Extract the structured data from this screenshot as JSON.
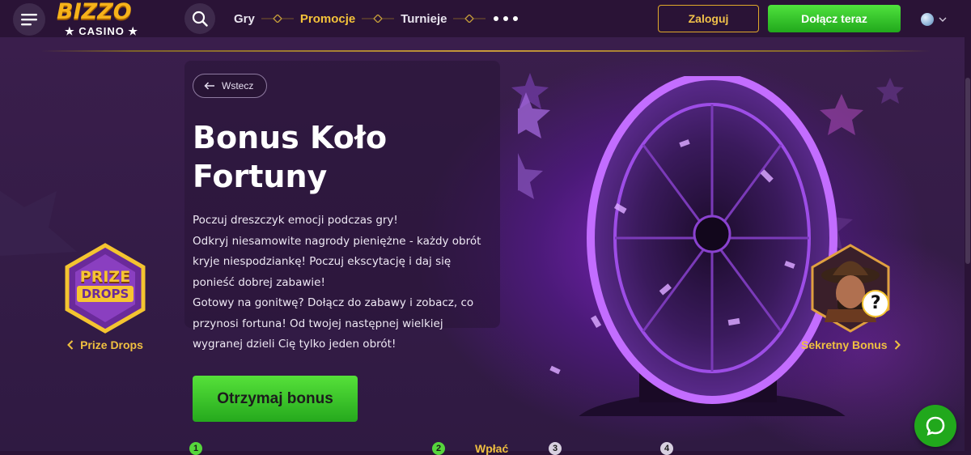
{
  "header": {
    "logo_text": "BIZZO",
    "logo_subtext": "★ CASINO ★",
    "nav": [
      {
        "label": "Gry",
        "active": false
      },
      {
        "label": "Promocje",
        "active": true
      },
      {
        "label": "Turnieje",
        "active": false
      }
    ],
    "login_label": "Zaloguj",
    "join_label": "Dołącz teraz"
  },
  "hero": {
    "back_label": "Wstecz",
    "title": "Bonus Koło Fortuny",
    "description": [
      "Poczuj dreszczyk emocji podczas gry!",
      "Odkryj niesamowite nagrody pieniężne - każdy obrót kryje niespodziankę! Poczuj ekscytację i daj się ponieść dobrej zabawie!",
      "Gotowy na gonitwę? Dołącz do zabawy i zobacz, co przynosi fortuna! Od twojej następnej wielkiej wygranej dzieli Cię tylko jeden obrót!"
    ],
    "cta_label": "Otrzymaj bonus",
    "prev_promo": {
      "label": "Prize Drops",
      "badge_line1": "PRIZE",
      "badge_line2": "DROPS"
    },
    "next_promo": {
      "label": "Sekretny Bonus"
    }
  },
  "steps": [
    {
      "number": "1",
      "text": ""
    },
    {
      "number": "2",
      "text": "Wpłać"
    },
    {
      "number": "3",
      "text": ""
    },
    {
      "number": "4",
      "text": ""
    }
  ],
  "colors": {
    "accent_gold": "#f0c040",
    "cta_green": "#3fc92d",
    "background": "#2a1336",
    "wheel_purple": "#a24ee8"
  },
  "icons": {
    "menu": "hamburger-icon",
    "search": "search-icon",
    "language": "globe-icon",
    "back": "arrow-left-icon",
    "chat": "chat-icon"
  }
}
